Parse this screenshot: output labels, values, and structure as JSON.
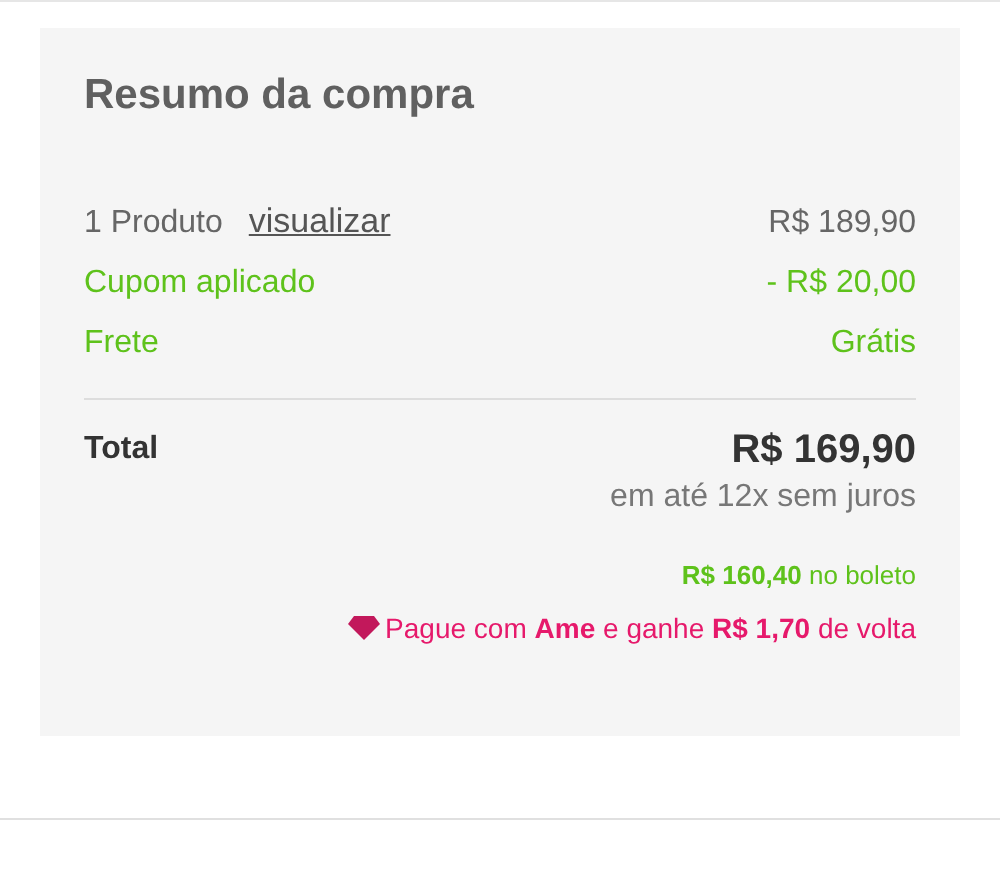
{
  "summary": {
    "title": "Resumo da compra",
    "rows": [
      {
        "kind": "item",
        "label": "1 Produto",
        "link": "visualizar",
        "value": "R$ 189,90"
      },
      {
        "kind": "discount",
        "label": "Cupom aplicado",
        "value": "- R$ 20,00"
      },
      {
        "kind": "discount",
        "label": "Frete",
        "value": "Grátis"
      }
    ],
    "total": {
      "label": "Total",
      "value": "R$ 169,90",
      "installments": "em até 12x sem juros"
    },
    "boleto": "**R$ 160,40** no boleto",
    "ame": "Pague com **Ame** e ganhe **R$ 1,70** de volta"
  }
}
